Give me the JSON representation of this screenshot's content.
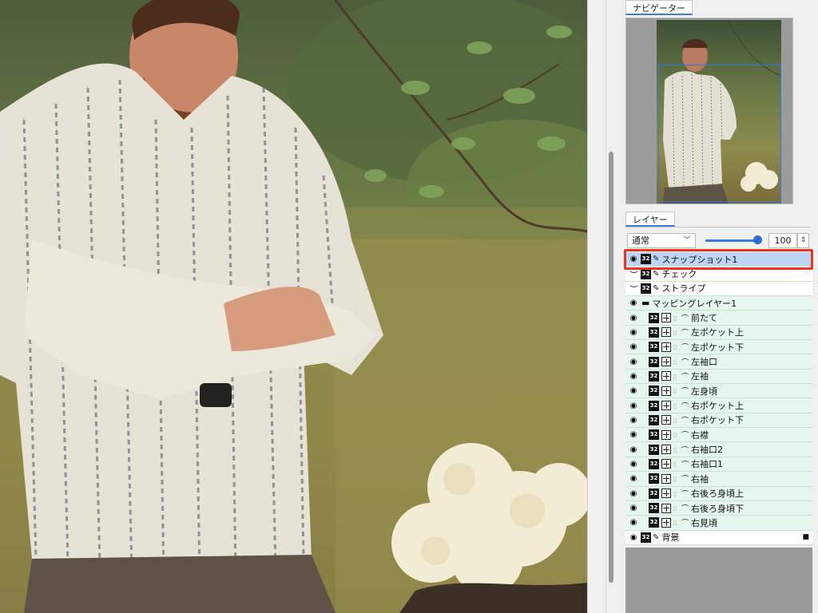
{
  "navigator": {
    "tab_label": "ナビゲーター"
  },
  "layers_panel": {
    "tab_label": "レイヤー",
    "blend_mode": "通常",
    "opacity": "100",
    "opacity_level": 1.0,
    "layers": [
      {
        "label": "スナップショット1",
        "visible": true,
        "kind": "pen",
        "selected": true,
        "style": "selected"
      },
      {
        "label": "チェック",
        "visible": false,
        "kind": "pen",
        "style": "plain"
      },
      {
        "label": "ストライプ",
        "visible": false,
        "kind": "pen",
        "style": "plain"
      },
      {
        "label": "マッピングレイヤー1",
        "visible": true,
        "kind": "folder",
        "style": "mapped"
      },
      {
        "label": "前たて",
        "visible": true,
        "kind": "map",
        "style": "mapped"
      },
      {
        "label": "左ポケット上",
        "visible": true,
        "kind": "map",
        "style": "mapped"
      },
      {
        "label": "左ポケット下",
        "visible": true,
        "kind": "map",
        "style": "mapped"
      },
      {
        "label": "左袖口",
        "visible": true,
        "kind": "map",
        "style": "mapped"
      },
      {
        "label": "左袖",
        "visible": true,
        "kind": "map",
        "style": "mapped"
      },
      {
        "label": "左身頃",
        "visible": true,
        "kind": "map",
        "style": "mapped"
      },
      {
        "label": "右ポケット上",
        "visible": true,
        "kind": "map",
        "style": "mapped"
      },
      {
        "label": "右ポケット下",
        "visible": true,
        "kind": "map",
        "style": "mapped"
      },
      {
        "label": "右襟",
        "visible": true,
        "kind": "map",
        "style": "mapped"
      },
      {
        "label": "右袖口2",
        "visible": true,
        "kind": "map",
        "style": "mapped"
      },
      {
        "label": "右袖口1",
        "visible": true,
        "kind": "map",
        "style": "mapped"
      },
      {
        "label": "右袖",
        "visible": true,
        "kind": "map",
        "style": "mapped"
      },
      {
        "label": "右後ろ身頃上",
        "visible": true,
        "kind": "map",
        "style": "mapped"
      },
      {
        "label": "右後ろ身頃下",
        "visible": true,
        "kind": "map",
        "style": "mapped"
      },
      {
        "label": "右見頃",
        "visible": true,
        "kind": "map",
        "style": "mapped"
      },
      {
        "label": "背景",
        "visible": true,
        "kind": "pen",
        "style": "plain",
        "locked": true
      }
    ]
  },
  "icons": {
    "eye": "eye-icon",
    "eye_closed": "eye-closed-icon",
    "bit_badge": "32",
    "pen": "pen-icon",
    "folder": "folder-icon",
    "lock": "lock-icon"
  },
  "colors": {
    "selection_outline": "#e8371f",
    "selected_row": "#bcd5f5",
    "mapped_row": "#e5f7ef",
    "accent": "#2c6fd1"
  }
}
